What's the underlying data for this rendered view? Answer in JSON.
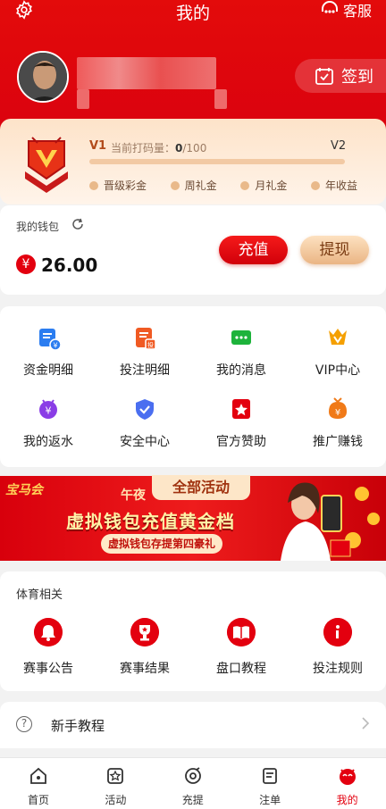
{
  "header": {
    "title": "我的",
    "service_label": "客服",
    "signin_label": "签到"
  },
  "vip": {
    "current_level": "V1",
    "progress_label": "当前打码量：",
    "progress_value": "0",
    "progress_target": "/100",
    "next_level": "V2",
    "progress_fraction": 0,
    "benefits": [
      "晋级彩金",
      "周礼金",
      "月礼金",
      "年收益"
    ]
  },
  "wallet": {
    "label": "我的钱包",
    "currency_symbol": "¥",
    "balance": "26.00",
    "recharge_label": "充值",
    "withdraw_label": "提现"
  },
  "menu": [
    {
      "label": "资金明细",
      "icon": "ledger-icon",
      "color": "#2b7df0"
    },
    {
      "label": "投注明细",
      "icon": "bet-record-icon",
      "color": "#f05a23"
    },
    {
      "label": "我的消息",
      "icon": "message-icon",
      "color": "#1db33b"
    },
    {
      "label": "VIP中心",
      "icon": "vip-crown-icon",
      "color": "#f5a000"
    },
    {
      "label": "我的返水",
      "icon": "rebate-icon",
      "color": "#8a3de6"
    },
    {
      "label": "安全中心",
      "icon": "shield-icon",
      "color": "#4a6ef0"
    },
    {
      "label": "官方赞助",
      "icon": "sponsor-star-icon",
      "color": "#e3000f"
    },
    {
      "label": "推广赚钱",
      "icon": "promote-money-icon",
      "color": "#f07a18"
    }
  ],
  "banner": {
    "tag": "全部活动",
    "logo_text": "宝马会",
    "headline_fragment": "午夜",
    "title": "虚拟钱包充值黄金档",
    "subtitle": "虚拟钱包存提第四豪礼"
  },
  "sports": {
    "title": "体育相关",
    "items": [
      {
        "label": "赛事公告",
        "icon": "bell-icon"
      },
      {
        "label": "赛事结果",
        "icon": "trophy-icon"
      },
      {
        "label": "盘口教程",
        "icon": "book-icon"
      },
      {
        "label": "投注规则",
        "icon": "info-icon"
      }
    ]
  },
  "guide": {
    "label": "新手教程",
    "icon_glyph": "?"
  },
  "tabs": [
    {
      "label": "首页",
      "icon": "home-icon"
    },
    {
      "label": "活动",
      "icon": "star-box-icon"
    },
    {
      "label": "充提",
      "icon": "recharge-icon"
    },
    {
      "label": "注单",
      "icon": "bet-slip-icon"
    },
    {
      "label": "我的",
      "icon": "profile-icon",
      "active": true
    }
  ],
  "colors": {
    "brand_red": "#e3000f",
    "vip_gold": "#eab584"
  }
}
